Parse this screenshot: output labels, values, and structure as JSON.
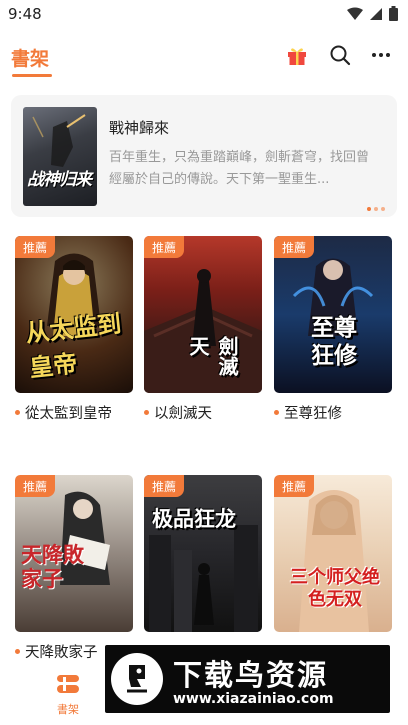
{
  "status": {
    "time": "9:48"
  },
  "header": {
    "title": "書架"
  },
  "banner": {
    "title": "戰神歸來",
    "description": "百年重生，只為重踏巔峰，劍斬蒼穹，找回曾經屬於自己的傳說。天下第一聖重生...",
    "cover_text": "战神归来"
  },
  "books": [
    {
      "badge": "推薦",
      "title": "從太監到皇帝",
      "cover_text": "从太监到皇帝"
    },
    {
      "badge": "推薦",
      "title": "以劍滅天",
      "cover_text": "劍滅天"
    },
    {
      "badge": "推薦",
      "title": "至尊狂修",
      "cover_text": "至尊狂修"
    },
    {
      "badge": "推薦",
      "title": "天降敗家子",
      "cover_text": "天降敗家子"
    },
    {
      "badge": "推薦",
      "title": "",
      "cover_text": "极品狂龙"
    },
    {
      "badge": "推薦",
      "title": "",
      "cover_text": "三个师父绝色无双"
    }
  ],
  "nav": {
    "bookshelf_label": "書架"
  },
  "watermark": {
    "title": "下载鸟资源",
    "url": "www.xiazainiao.com"
  },
  "colors": {
    "accent": "#f27a3a"
  }
}
